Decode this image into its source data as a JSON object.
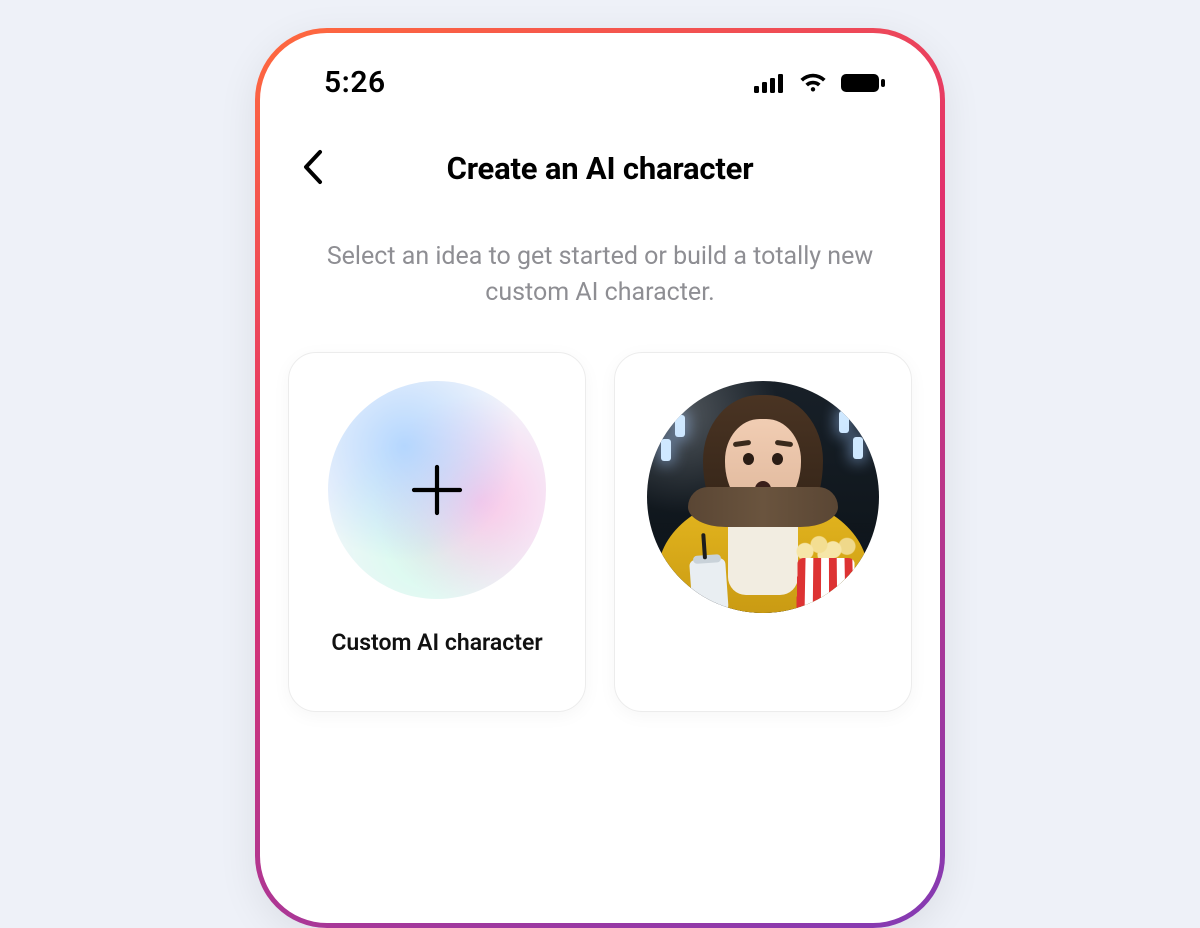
{
  "status": {
    "time": "5:26",
    "icons": {
      "signal": "signal-icon",
      "wifi": "wifi-icon",
      "battery": "battery-icon"
    }
  },
  "header": {
    "back_icon": "chevron-left-icon",
    "title": "Create an AI character"
  },
  "subtitle": "Select an idea to get started or build a totally new custom AI character.",
  "cards": {
    "custom": {
      "icon": "plus-icon",
      "label": "Custom AI character"
    },
    "suggested": {
      "avatar_name": "character-avatar"
    }
  },
  "colors": {
    "frame_gradient_start": "#ff6a3d",
    "frame_gradient_mid": "#e1306c",
    "frame_gradient_end": "#833ab4",
    "page_bg": "#eef1f8",
    "text_primary": "#000000",
    "text_secondary": "#8e8e93"
  }
}
